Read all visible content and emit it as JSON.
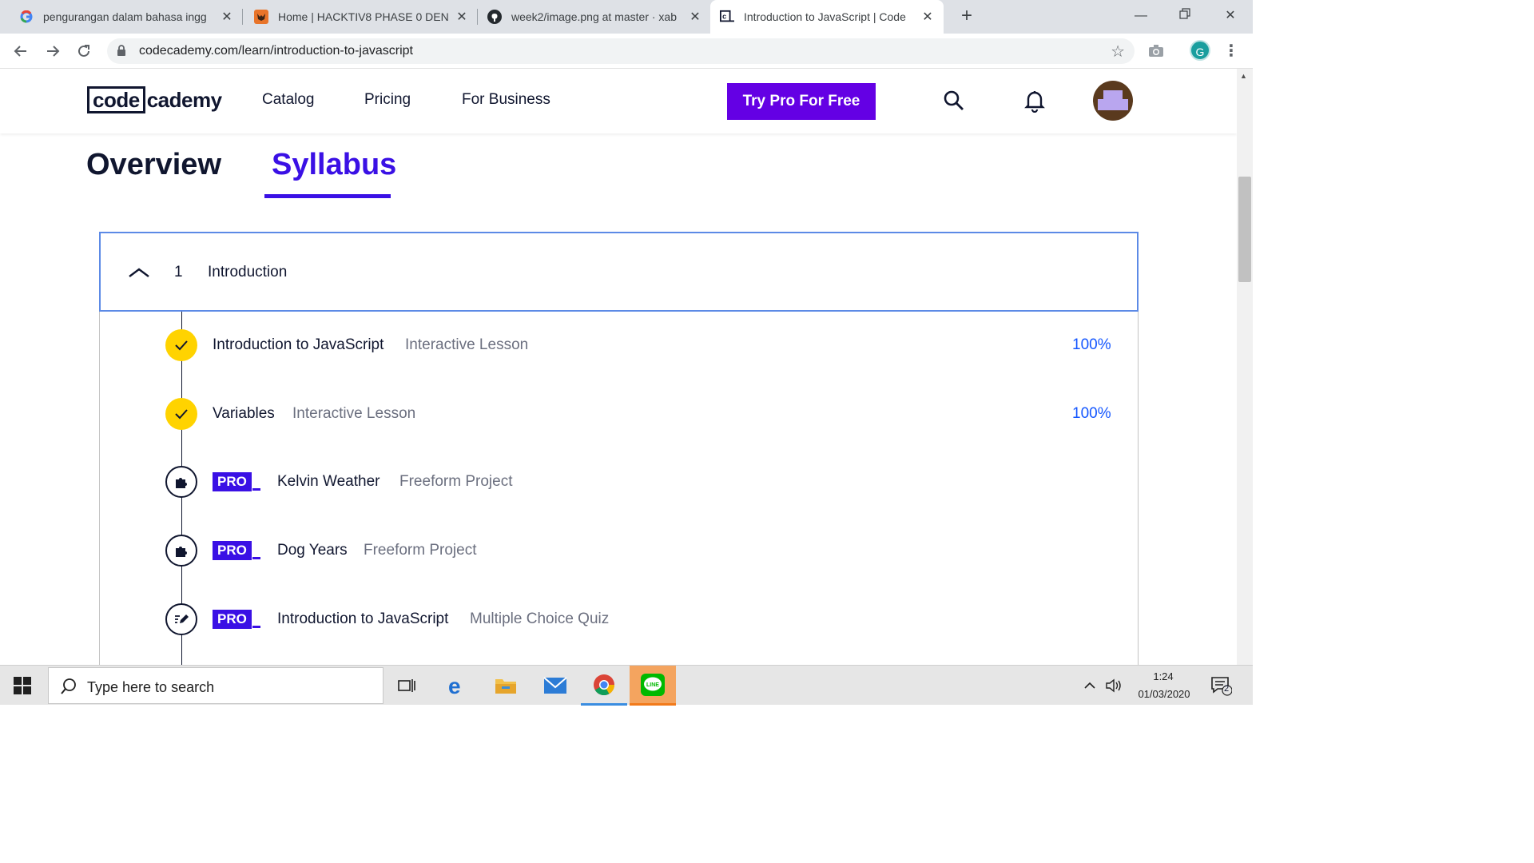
{
  "browser": {
    "tabs": [
      {
        "title": "pengurangan dalam bahasa ingg",
        "icon": "google-icon"
      },
      {
        "title": "Home | HACKTIV8 PHASE 0 DEN",
        "icon": "hacktiv8-fox-icon"
      },
      {
        "title": "week2/image.png at master · xab",
        "icon": "github-icon"
      },
      {
        "title": "Introduction to JavaScript | Code",
        "icon": "codecademy-icon",
        "active": true
      }
    ],
    "url": "codecademy.com/learn/introduction-to-javascript",
    "profile_initial": "G"
  },
  "site": {
    "logo_boxed": "code",
    "logo_rest": "cademy",
    "nav": [
      "Catalog",
      "Pricing",
      "For Business"
    ],
    "cta": "Try Pro For Free",
    "accent": "#6400e4"
  },
  "course_tabs": {
    "overview": "Overview",
    "syllabus": "Syllabus",
    "active": "Syllabus"
  },
  "section": {
    "number": "1",
    "title": "Introduction"
  },
  "lessons": [
    {
      "title": "Introduction to JavaScript",
      "type": "Interactive Lesson",
      "progress": "100%",
      "status": "complete",
      "pro": false,
      "icon": "check-icon"
    },
    {
      "title": "Variables",
      "type": "Interactive Lesson",
      "progress": "100%",
      "status": "complete",
      "pro": false,
      "icon": "check-icon"
    },
    {
      "title": "Kelvin Weather",
      "type": "Freeform Project",
      "status": "locked",
      "pro": true,
      "pro_label": "PRO",
      "icon": "puzzle-icon"
    },
    {
      "title": "Dog Years",
      "type": "Freeform Project",
      "status": "locked",
      "pro": true,
      "pro_label": "PRO",
      "icon": "puzzle-icon"
    },
    {
      "title": "Introduction to JavaScript",
      "type": "Multiple Choice Quiz",
      "status": "locked",
      "pro": true,
      "pro_label": "PRO",
      "icon": "quiz-pencil-icon"
    }
  ],
  "taskbar": {
    "search_placeholder": "Type here to search",
    "time": "1:24",
    "date": "01/03/2020",
    "notification_count": "2"
  }
}
